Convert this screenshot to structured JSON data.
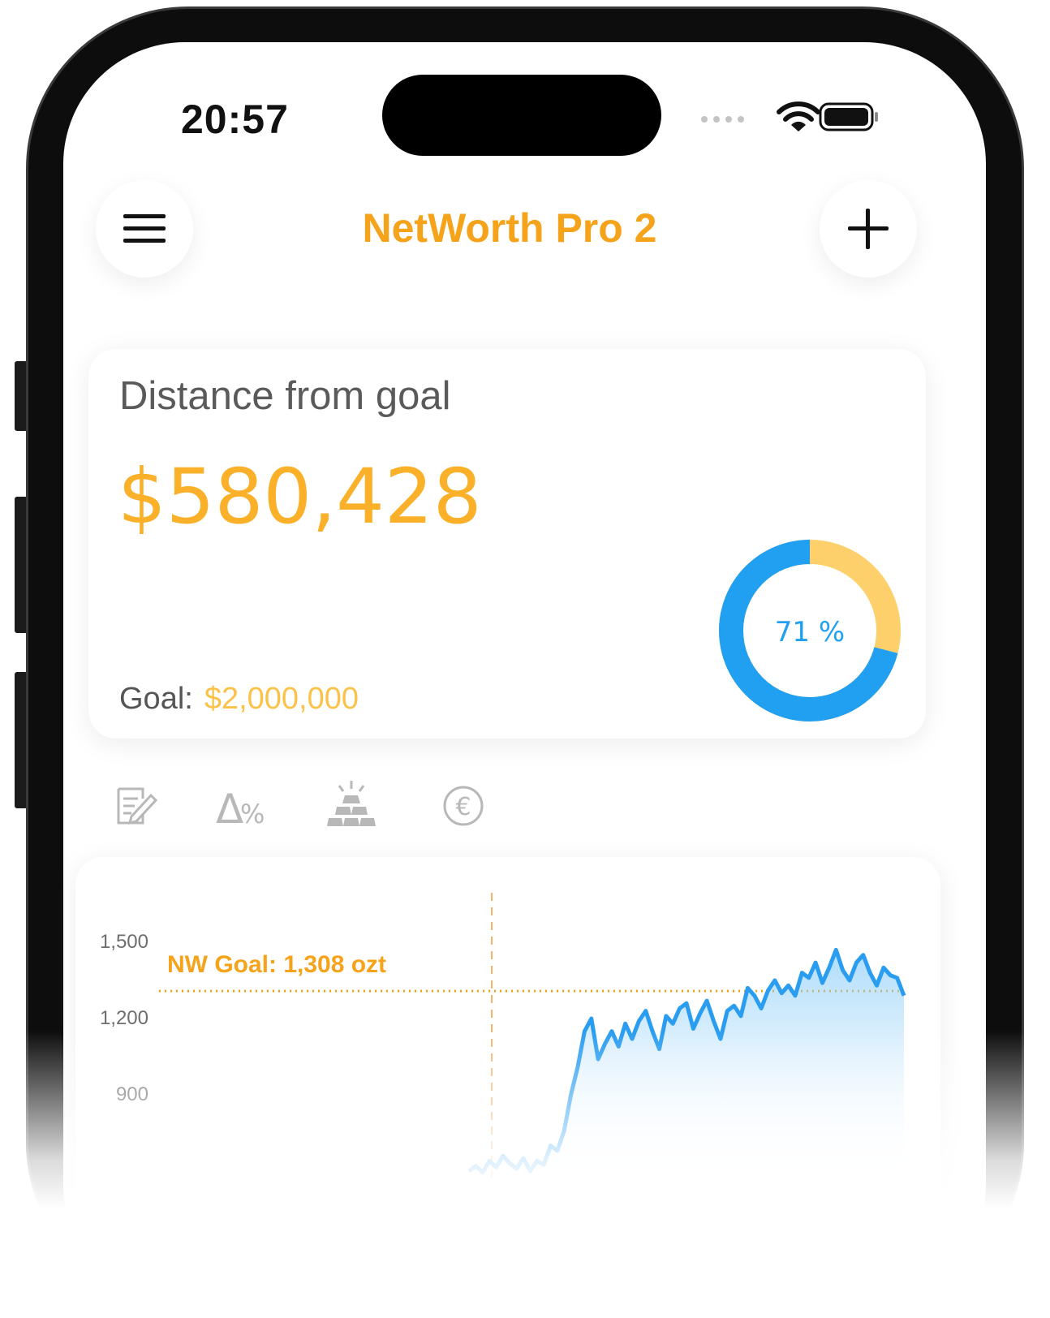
{
  "status_bar": {
    "time": "20:57"
  },
  "header": {
    "title": "NetWorth Pro 2",
    "menu_icon": "hamburger-icon",
    "add_icon": "plus-icon"
  },
  "goal_card": {
    "title": "Distance from goal",
    "distance": "$580,428",
    "goal_label": "Goal:",
    "goal_value": "$2,000,000",
    "progress_label": "71 %",
    "progress_fraction": 0.71
  },
  "toolbar": {
    "icons": [
      "edit-note-icon",
      "delta-percent-icon",
      "gold-bars-icon",
      "euro-coin-icon"
    ],
    "euro_symbol": "€",
    "delta_symbol": "Δ",
    "percent_symbol": "%"
  },
  "chart_data": {
    "type": "area",
    "y_ticks": [
      "1,500",
      "1,200",
      "900"
    ],
    "ylim": [
      600,
      1650
    ],
    "goal_label": "NW Goal: 1,308 ozt",
    "goal_value": 1308,
    "values": [
      600,
      620,
      595,
      640,
      615,
      660,
      630,
      610,
      650,
      600,
      640,
      625,
      700,
      680,
      760,
      900,
      1010,
      1150,
      1200,
      1040,
      1100,
      1150,
      1090,
      1180,
      1120,
      1190,
      1230,
      1150,
      1080,
      1210,
      1180,
      1240,
      1260,
      1160,
      1220,
      1270,
      1190,
      1120,
      1230,
      1250,
      1210,
      1320,
      1290,
      1240,
      1310,
      1350,
      1300,
      1330,
      1290,
      1380,
      1360,
      1420,
      1340,
      1400,
      1470,
      1390,
      1350,
      1420,
      1450,
      1380,
      1330,
      1400,
      1370,
      1360,
      1290
    ],
    "colors": {
      "line": "#2a9df0",
      "fill": "#d7ecfc",
      "goal": "#f5a31a",
      "donut_progress": "#21a0f2",
      "donut_remaining": "#fdd06b"
    }
  }
}
